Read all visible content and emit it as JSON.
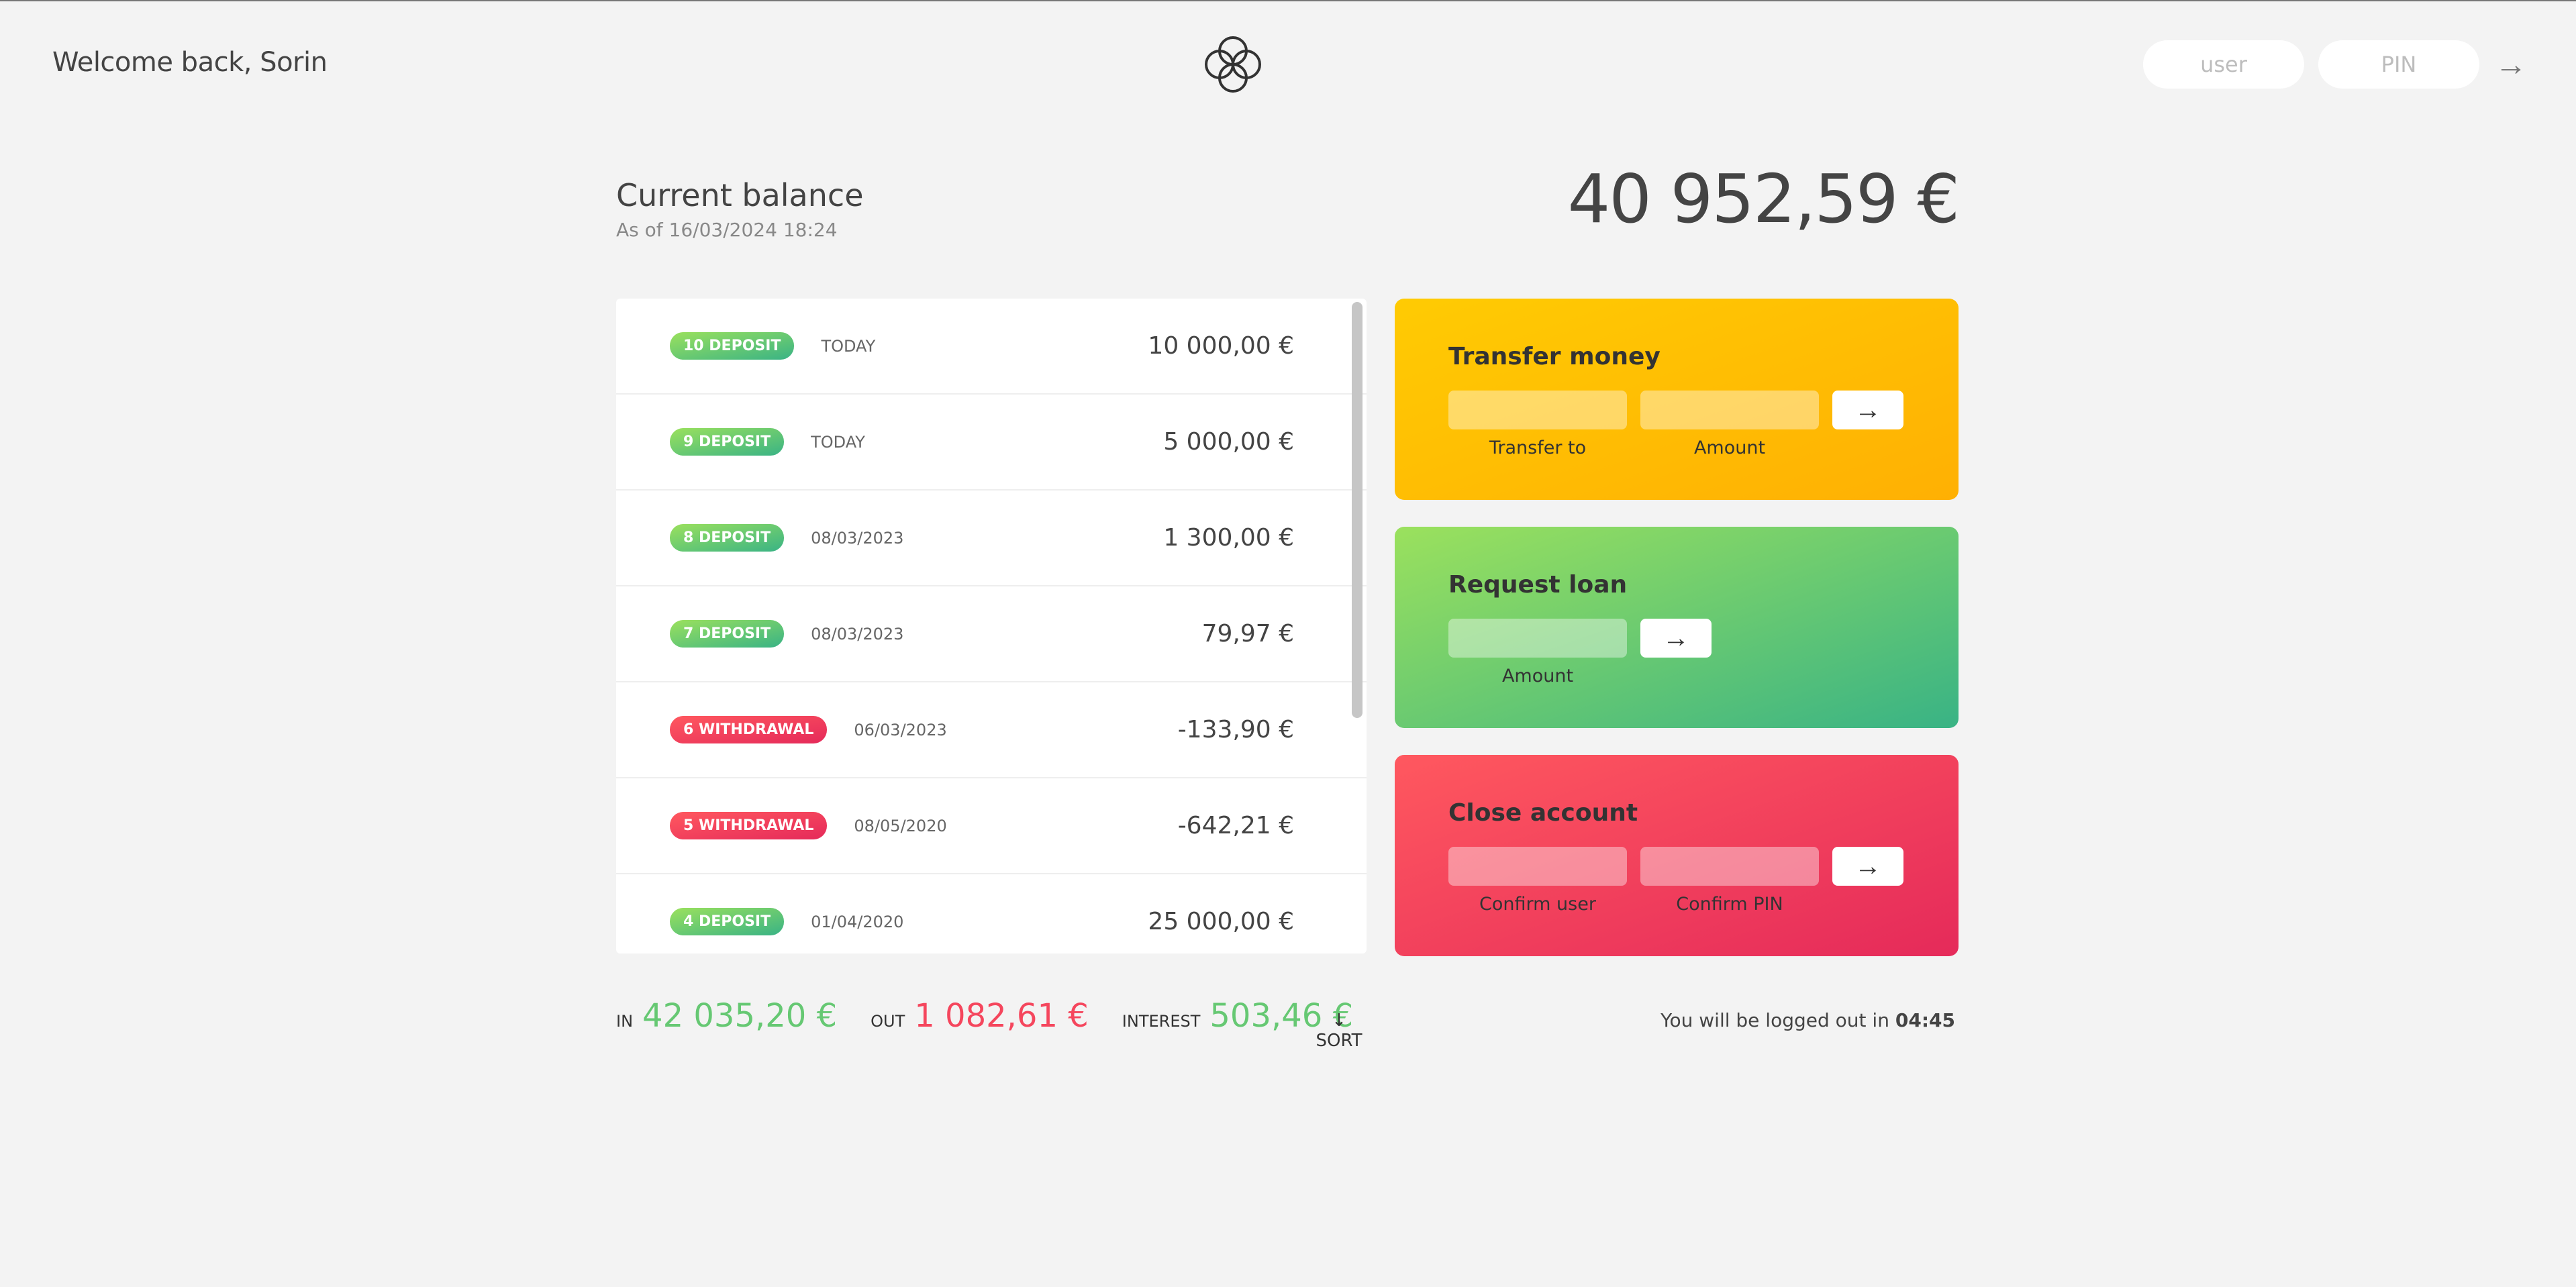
{
  "nav": {
    "welcome": "Welcome back, Sorin",
    "user_placeholder": "user",
    "pin_placeholder": "PIN",
    "login_icon": "→"
  },
  "balance": {
    "label": "Current balance",
    "date": "As of 16/03/2024 18:24",
    "value": "40 952,59 €"
  },
  "movements": [
    {
      "type": "10 deposit",
      "kind": "deposit",
      "date": "Today",
      "value": "10 000,00 €"
    },
    {
      "type": "9 deposit",
      "kind": "deposit",
      "date": "Today",
      "value": "5 000,00 €"
    },
    {
      "type": "8 deposit",
      "kind": "deposit",
      "date": "08/03/2023",
      "value": "1 300,00 €"
    },
    {
      "type": "7 deposit",
      "kind": "deposit",
      "date": "08/03/2023",
      "value": "79,97 €"
    },
    {
      "type": "6 withdrawal",
      "kind": "withdrawal",
      "date": "06/03/2023",
      "value": "-133,90 €"
    },
    {
      "type": "5 withdrawal",
      "kind": "withdrawal",
      "date": "08/05/2020",
      "value": "-642,21 €"
    },
    {
      "type": "4 deposit",
      "kind": "deposit",
      "date": "01/04/2020",
      "value": "25 000,00 €"
    }
  ],
  "operations": {
    "transfer": {
      "title": "Transfer money",
      "label_to": "Transfer to",
      "label_amount": "Amount",
      "button": "→"
    },
    "loan": {
      "title": "Request loan",
      "label_amount": "Amount",
      "button": "→"
    },
    "close": {
      "title": "Close account",
      "label_user": "Confirm user",
      "label_pin": "Confirm PIN",
      "button": "→"
    }
  },
  "summary": {
    "in_label": "In",
    "in_value": "42 035,20 €",
    "out_label": "Out",
    "out_value": "1 082,61 €",
    "interest_label": "Interest",
    "interest_value": "503,46 €",
    "sort_icon": "↓",
    "sort_label": "SORT"
  },
  "logout": {
    "text": "You will be logged out in",
    "time": "04:45"
  },
  "colors": {
    "deposit": "#66c873",
    "withdrawal": "#f5465d",
    "transfer": "#ffb003",
    "loan": "#39b385",
    "close": "#e52a5a"
  }
}
